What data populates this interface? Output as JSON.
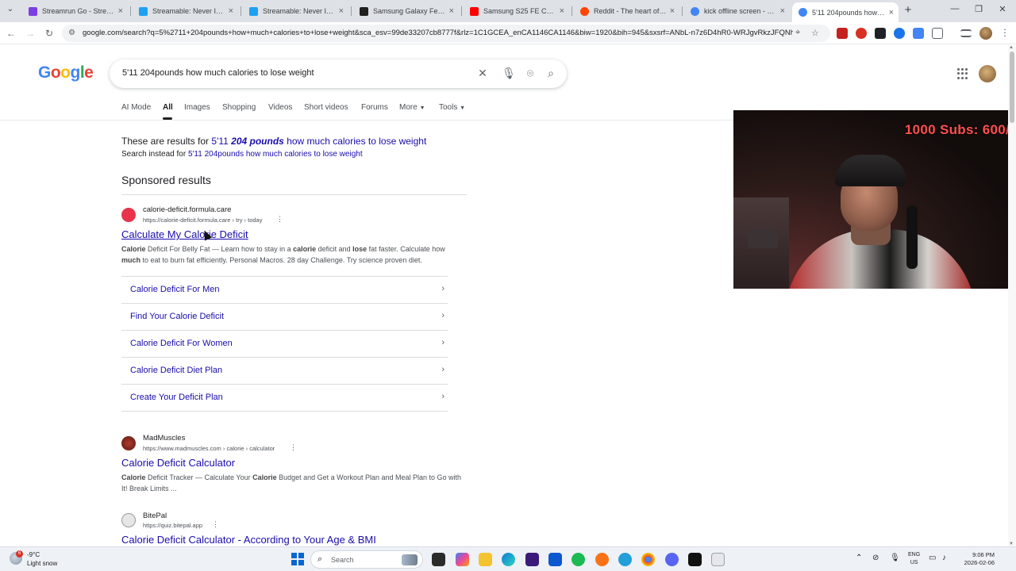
{
  "browser": {
    "tabs": [
      {
        "title": "Streamrun Go - Streamrun",
        "favicon_color": "#7b3fe4"
      },
      {
        "title": "Streamable: Never IRL Str",
        "favicon_color": "#1da1f2"
      },
      {
        "title": "Streamable: Never IRL Str",
        "favicon_color": "#1da1f2"
      },
      {
        "title": "Samsung Galaxy Fe S25 fo",
        "favicon_color": "#1f1f1f"
      },
      {
        "title": "Samsung S25 FE Camera",
        "favicon_color": "#ff0000"
      },
      {
        "title": "Reddit - The heart of the",
        "favicon_color": "#ff4500"
      },
      {
        "title": "kick offline screen - Goog",
        "favicon_color": "#4285f4"
      },
      {
        "title": "5'11 204pounds how mu",
        "favicon_color": "#4285f4"
      }
    ],
    "active_tab_index": 7,
    "new_tab_symbol": "+",
    "close_symbol": "×",
    "window_controls": {
      "minimize": "—",
      "restore": "❐",
      "close": "✕"
    },
    "address": "google.com/search?q=5%2711+204pounds+how+much+calories+to+lose+weight&sca_esv=99de33207cb8777f&rlz=1C1GCEA_enCA1146CA1146&biw=1920&bih=945&sxsrf=ANbL-n7z6D4hR0-WRJgvRkzJFQNh..."
  },
  "google": {
    "logo": [
      "G",
      "o",
      "o",
      "g",
      "l",
      "e"
    ],
    "query": "5'11 204pounds how much calories to lose weight",
    "nav_tabs": [
      "AI Mode",
      "All",
      "Images",
      "Shopping",
      "Videos",
      "Short videos",
      "Forums",
      "More",
      "Tools"
    ],
    "active_nav_tab": "All",
    "correction_prefix": "These are results for",
    "correction_part1": "5'11",
    "correction_bold": "204 pounds",
    "correction_part2": "how much calories to lose weight",
    "instead_prefix": "Search instead for",
    "instead_query": "5'11 204pounds how much calories to lose weight",
    "sponsored_heading": "Sponsored results"
  },
  "ad_result": {
    "site_name": "calorie-deficit.formula.care",
    "url": "https://calorie-deficit.formula.care › try › today",
    "title": "Calculate My Calorie Deficit",
    "snippet_b1": "Calorie",
    "snippet_t1": " Deficit For Belly Fat — Learn how to stay in a ",
    "snippet_b2": "calorie",
    "snippet_t2": " deficit and ",
    "snippet_b3": "lose",
    "snippet_t3": " fat faster. Calculate how ",
    "snippet_b4": "much",
    "snippet_t4": " to eat to burn fat efficiently. Personal Macros. 28 day Challenge. Try science proven diet.",
    "sitelinks": [
      "Calorie Deficit For Men",
      "Find Your Calorie Deficit",
      "Calorie Deficit For Women",
      "Calorie Deficit Diet Plan",
      "Create Your Deficit Plan"
    ]
  },
  "results": [
    {
      "site_name": "MadMuscles",
      "url": "https://www.madmuscles.com › calorie › calculator",
      "title": "Calorie Deficit Calculator",
      "snippet_b1": "Calorie",
      "snippet_t1": " Deficit Tracker — Calculate Your ",
      "snippet_b2": "Calorie",
      "snippet_t2": " Budget and Get a Workout Plan and Meal Plan to Go with It! Break Limits ..."
    },
    {
      "site_name": "BitePal",
      "url": "https://quiz.bitepal.app",
      "title": "Calorie Deficit Calculator - According to Your Age & BMI"
    }
  ],
  "webcam": {
    "overlay_text": "1000 Subs: 600/"
  },
  "taskbar": {
    "weather_badge": "6",
    "weather_temp": "-9°C",
    "weather_cond": "Light snow",
    "search_label": "Search",
    "lang_top": "ENG",
    "lang_bottom": "US",
    "time": "9:06 PM",
    "date": "2026-02-06"
  }
}
